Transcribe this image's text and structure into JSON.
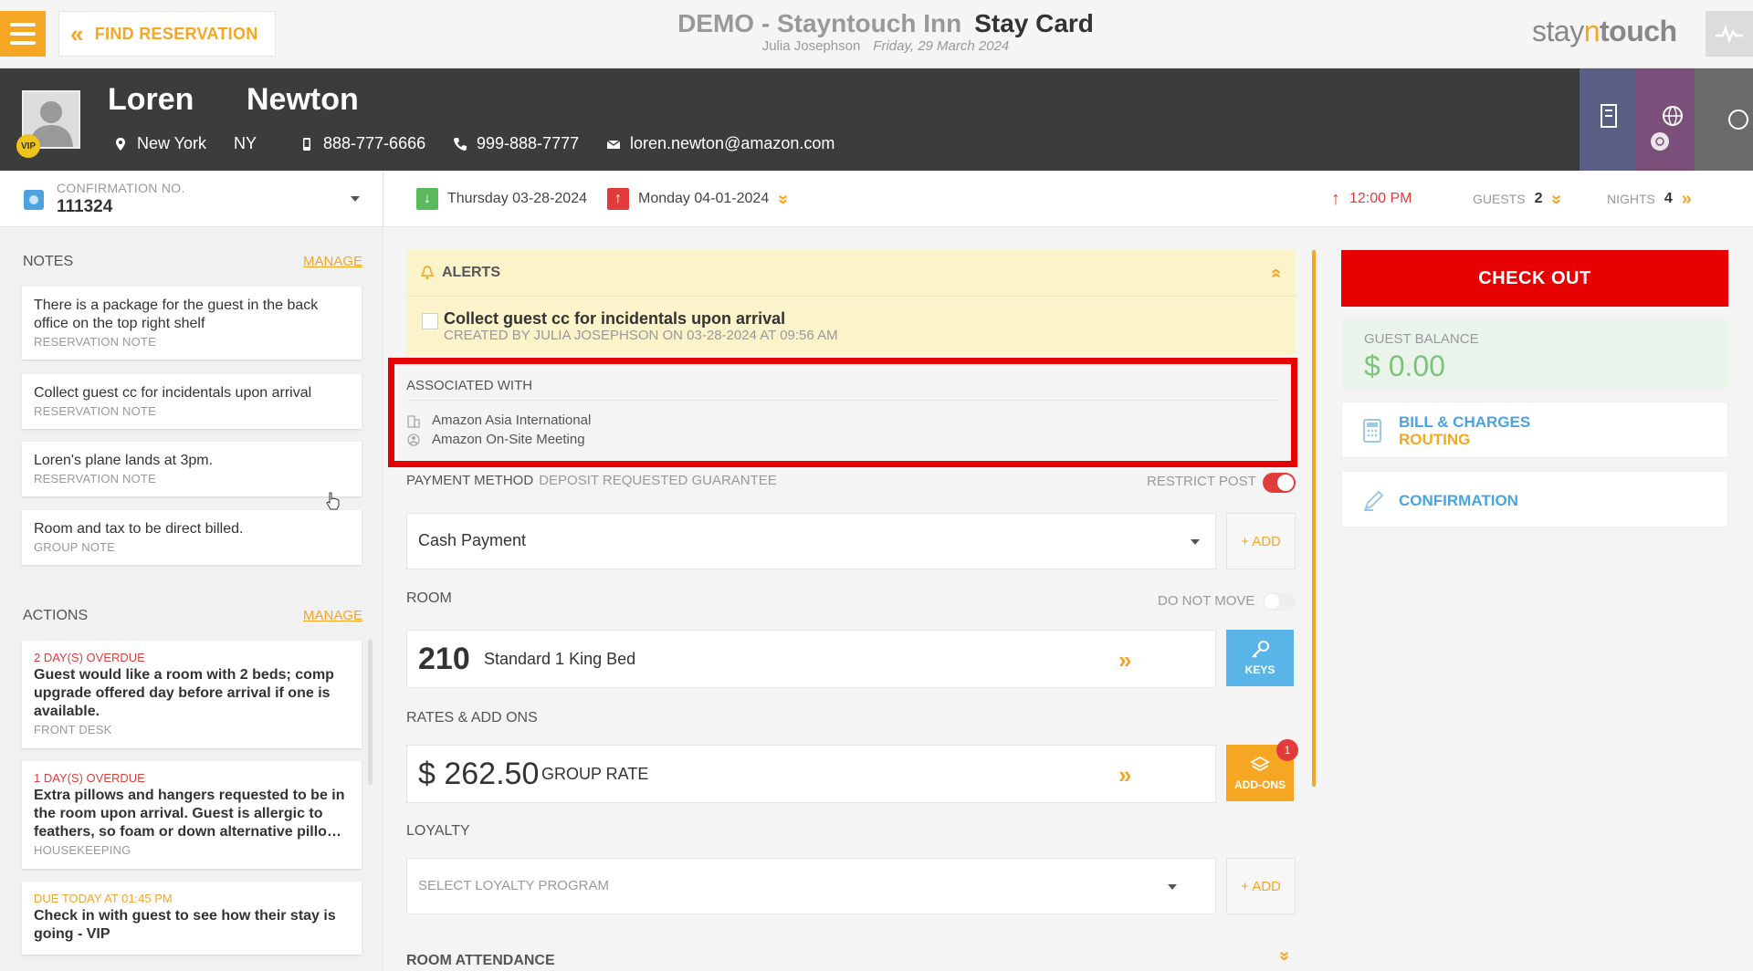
{
  "topbar": {
    "find_reservation_label": "FIND RESERVATION",
    "hotel_name": "DEMO - Stayntouch Inn",
    "page_title": "Stay Card",
    "user_name": "Julia Josephson",
    "business_date": "Friday, 29 March 2024",
    "logo_a": "stay",
    "logo_n": "n",
    "logo_b": "touch"
  },
  "guest": {
    "first_name": "Loren",
    "last_name": "Newton",
    "vip_label": "VIP",
    "city": "New York",
    "state": "NY",
    "mobile": "888-777-6666",
    "phone": "999-888-7777",
    "email": "loren.newton@amazon.com"
  },
  "reservation": {
    "confirmation_label": "CONFIRMATION NO.",
    "confirmation_number": "111324",
    "arrival": "Thursday 03-28-2024",
    "departure": "Monday 04-01-2024",
    "departure_time": "12:00 PM",
    "guests_label": "GUESTS",
    "guests_count": "2",
    "nights_label": "NIGHTS",
    "nights_count": "4"
  },
  "notes": {
    "heading": "NOTES",
    "manage": "MANAGE",
    "items": [
      {
        "text": "There is a package for the guest in the back office on the top right shelf",
        "type": "RESERVATION NOTE"
      },
      {
        "text": "Collect guest cc for incidentals upon arrival",
        "type": "RESERVATION NOTE"
      },
      {
        "text": "Loren's plane lands at 3pm.",
        "type": "RESERVATION NOTE"
      },
      {
        "text": "Room and tax to be direct billed.",
        "type": "GROUP NOTE"
      }
    ]
  },
  "actions": {
    "heading": "ACTIONS",
    "manage": "MANAGE",
    "items": [
      {
        "due": "2 DAY(S) OVERDUE",
        "text": "Guest would like a room with 2 beds; comp upgrade offered day before arrival if one is available.",
        "dept": "FRONT DESK"
      },
      {
        "due": "1 DAY(S) OVERDUE",
        "text": "Extra pillows and hangers requested to be in the room upon arrival. Guest is allergic to feathers, so foam or down alternative pillo…",
        "dept": "HOUSEKEEPING"
      },
      {
        "due": "DUE TODAY AT 01:45 PM",
        "text": "Check in with guest to see how their stay is going - VIP",
        "dept": ""
      }
    ]
  },
  "alerts": {
    "heading": "ALERTS",
    "item_title": "Collect guest cc for incidentals upon arrival",
    "item_meta": "CREATED BY JULIA JOSEPHSON ON 03-28-2024 AT 09:56 AM"
  },
  "associated": {
    "label": "ASSOCIATED WITH",
    "company": "Amazon Asia International",
    "group": "Amazon On-Site Meeting"
  },
  "payment": {
    "label": "PAYMENT METHOD",
    "sub_label": "DEPOSIT REQUESTED GUARANTEE",
    "restrict_label": "RESTRICT POST",
    "restrict_on": true,
    "method": "Cash Payment",
    "add_label": "+ ADD"
  },
  "room": {
    "label": "ROOM",
    "do_not_move_label": "DO NOT MOVE",
    "number": "210",
    "type": "Standard 1 King Bed",
    "keys_label": "KEYS"
  },
  "rates": {
    "label": "RATES & ADD ONS",
    "amount": "$ 262.50",
    "rate_name": "GROUP RATE",
    "addons_label": "ADD-ONS",
    "addons_count": "1"
  },
  "loyalty": {
    "label": "LOYALTY",
    "placeholder": "SELECT LOYALTY PROGRAM",
    "add_label": "+ ADD"
  },
  "attendance": {
    "label": "ROOM ATTENDANCE"
  },
  "right": {
    "checkout_label": "CHECK OUT",
    "balance_label": "GUEST BALANCE",
    "balance_value": "$ 0.00",
    "bill_line1": "BILL & CHARGES",
    "bill_line2": "ROUTING",
    "confirmation_label": "CONFIRMATION"
  },
  "colors": {
    "accent": "#f5a623",
    "danger": "#e60000",
    "info": "#4aa3df",
    "header_dark": "#3c3c3c",
    "positive": "#7cc47c"
  }
}
